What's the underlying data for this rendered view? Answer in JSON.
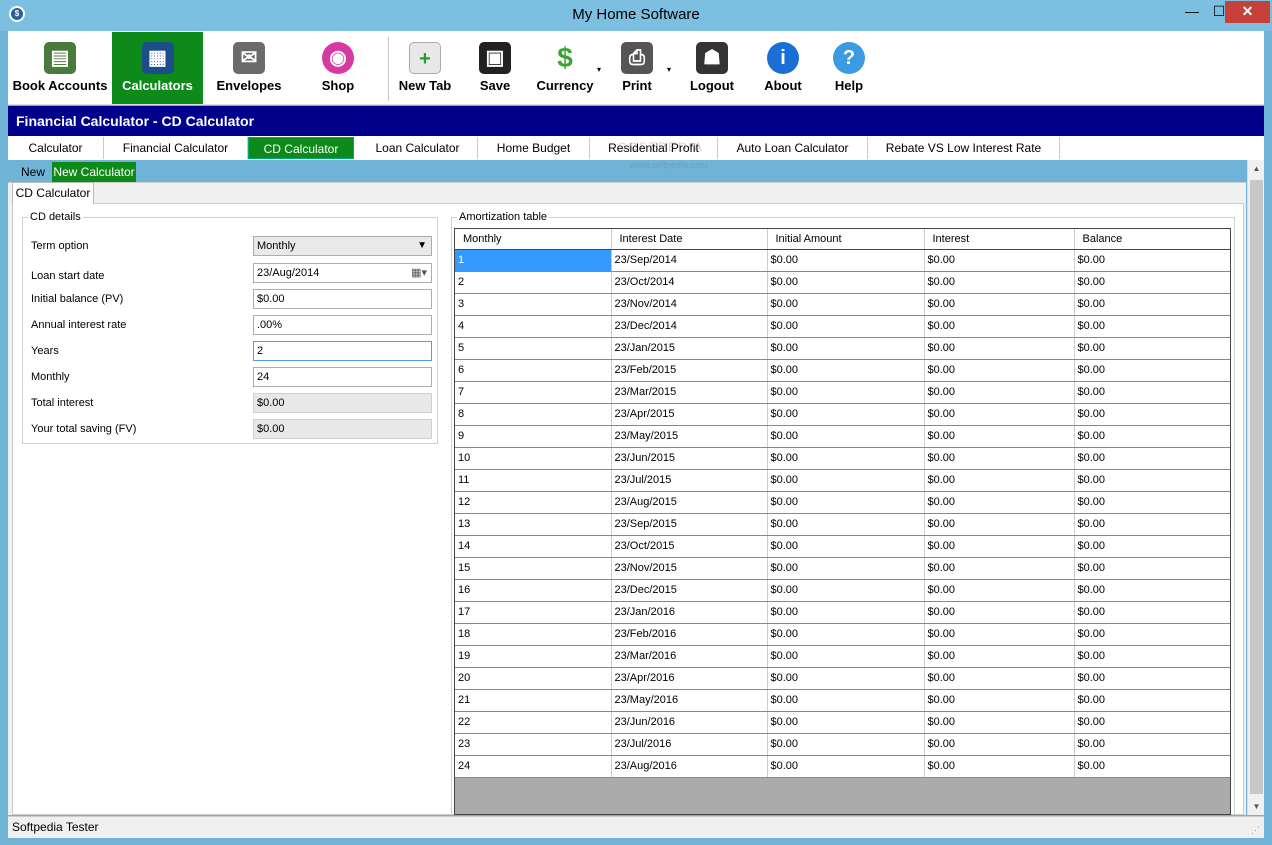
{
  "window": {
    "title": "My Home Software",
    "min": "—",
    "max": "☐",
    "close": "✕"
  },
  "colors": {
    "accent_green": "#0d8a1a",
    "header_blue": "#00008b",
    "selection": "#3399ff"
  },
  "toolbar": {
    "book_accounts": "Book Accounts",
    "calculators": "Calculators",
    "envelopes": "Envelopes",
    "shop": "Shop",
    "new_tab": "New Tab",
    "save": "Save",
    "currency": "Currency",
    "print": "Print",
    "logout": "Logout",
    "about": "About",
    "help": "Help",
    "caret": "▾"
  },
  "header": {
    "title": "Financial Calculator - CD Calculator"
  },
  "tabs": [
    {
      "label": "Calculator"
    },
    {
      "label": "Financial Calculator"
    },
    {
      "label": "CD Calculator"
    },
    {
      "label": "Loan Calculator"
    },
    {
      "label": "Home Budget"
    },
    {
      "label": "Residential Profit"
    },
    {
      "label": "Auto Loan Calculator"
    },
    {
      "label": "Rebate VS Low Interest Rate"
    }
  ],
  "watermark": {
    "text": "SOFTPEDIA",
    "sub": "www.softpedia.com"
  },
  "subtabs": {
    "new": "New",
    "new_calculator": "New Calculator"
  },
  "inner_tab": {
    "label": "CD Calculator"
  },
  "cd_details": {
    "legend": "CD details",
    "term_option": {
      "label": "Term option",
      "value": "Monthly"
    },
    "loan_start_date": {
      "label": "Loan start date",
      "value": "23/Aug/2014"
    },
    "initial_balance": {
      "label": "Initial balance (PV)",
      "value": "$0.00"
    },
    "annual_interest_rate": {
      "label": "Annual interest rate",
      "value": ".00%"
    },
    "years": {
      "label": "Years",
      "value": "2"
    },
    "monthly": {
      "label": "Monthly",
      "value": "24"
    },
    "total_interest": {
      "label": "Total interest",
      "value": "$0.00"
    },
    "total_saving": {
      "label": "Your total saving (FV)",
      "value": "$0.00"
    }
  },
  "amortization": {
    "legend": "Amortization table",
    "columns": [
      "Monthly",
      "Interest Date",
      "Initial Amount",
      "Interest",
      "Balance"
    ],
    "rows": [
      [
        "1",
        "23/Sep/2014",
        "$0.00",
        "$0.00",
        "$0.00"
      ],
      [
        "2",
        "23/Oct/2014",
        "$0.00",
        "$0.00",
        "$0.00"
      ],
      [
        "3",
        "23/Nov/2014",
        "$0.00",
        "$0.00",
        "$0.00"
      ],
      [
        "4",
        "23/Dec/2014",
        "$0.00",
        "$0.00",
        "$0.00"
      ],
      [
        "5",
        "23/Jan/2015",
        "$0.00",
        "$0.00",
        "$0.00"
      ],
      [
        "6",
        "23/Feb/2015",
        "$0.00",
        "$0.00",
        "$0.00"
      ],
      [
        "7",
        "23/Mar/2015",
        "$0.00",
        "$0.00",
        "$0.00"
      ],
      [
        "8",
        "23/Apr/2015",
        "$0.00",
        "$0.00",
        "$0.00"
      ],
      [
        "9",
        "23/May/2015",
        "$0.00",
        "$0.00",
        "$0.00"
      ],
      [
        "10",
        "23/Jun/2015",
        "$0.00",
        "$0.00",
        "$0.00"
      ],
      [
        "11",
        "23/Jul/2015",
        "$0.00",
        "$0.00",
        "$0.00"
      ],
      [
        "12",
        "23/Aug/2015",
        "$0.00",
        "$0.00",
        "$0.00"
      ],
      [
        "13",
        "23/Sep/2015",
        "$0.00",
        "$0.00",
        "$0.00"
      ],
      [
        "14",
        "23/Oct/2015",
        "$0.00",
        "$0.00",
        "$0.00"
      ],
      [
        "15",
        "23/Nov/2015",
        "$0.00",
        "$0.00",
        "$0.00"
      ],
      [
        "16",
        "23/Dec/2015",
        "$0.00",
        "$0.00",
        "$0.00"
      ],
      [
        "17",
        "23/Jan/2016",
        "$0.00",
        "$0.00",
        "$0.00"
      ],
      [
        "18",
        "23/Feb/2016",
        "$0.00",
        "$0.00",
        "$0.00"
      ],
      [
        "19",
        "23/Mar/2016",
        "$0.00",
        "$0.00",
        "$0.00"
      ],
      [
        "20",
        "23/Apr/2016",
        "$0.00",
        "$0.00",
        "$0.00"
      ],
      [
        "21",
        "23/May/2016",
        "$0.00",
        "$0.00",
        "$0.00"
      ],
      [
        "22",
        "23/Jun/2016",
        "$0.00",
        "$0.00",
        "$0.00"
      ],
      [
        "23",
        "23/Jul/2016",
        "$0.00",
        "$0.00",
        "$0.00"
      ],
      [
        "24",
        "23/Aug/2016",
        "$0.00",
        "$0.00",
        "$0.00"
      ]
    ]
  },
  "status": {
    "text": "Softpedia Tester"
  }
}
